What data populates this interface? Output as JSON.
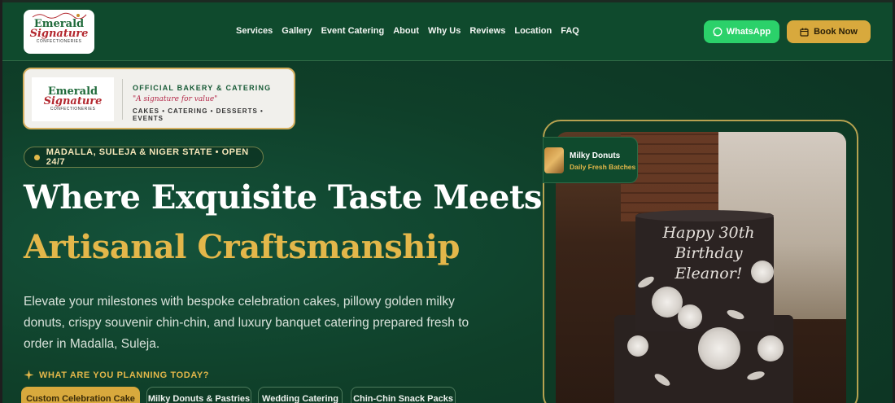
{
  "header": {
    "logo": {
      "line1": "Emerald",
      "line2": "Signature",
      "line3": "CONFECTIONERIES"
    },
    "nav": [
      "Services",
      "Gallery",
      "Event Catering",
      "About",
      "Why Us",
      "Reviews",
      "Location",
      "FAQ"
    ],
    "whatsapp_label": "WhatsApp",
    "book_label": "Book Now"
  },
  "badge": {
    "title": "OFFICIAL BAKERY & CATERING",
    "tagline": "\"A signature for value\"",
    "categories": "CAKES  •  CATERING  •  DESSERTS  •  EVENTS"
  },
  "hero": {
    "location": "MADALLA, SULEJA & NIGER STATE • OPEN 24/7",
    "headline_line1": "Where Exquisite Taste Meets",
    "headline_line2": "Artisanal Craftsmanship",
    "description": "Elevate your milestones with bespoke celebration cakes, pillowy golden milky donuts, crispy souvenir chin-chin, and luxury banquet catering prepared fresh to order in Madalla, Suleja.",
    "plan_label": "WHAT ARE YOU PLANNING TODAY?",
    "chips": [
      "Custom Celebration Cake",
      "Milky Donuts & Pastries",
      "Wedding Catering",
      "Chin-Chin Snack Packs"
    ],
    "active_chip_index": 0
  },
  "feature": {
    "tag_title": "Milky Donuts",
    "tag_sub": "Daily Fresh Batches",
    "cake_text": "Happy 30th Birthday Eleanor!"
  },
  "colors": {
    "accent_gold": "#d8a93d",
    "whatsapp_green": "#2bd16a",
    "header_green": "#0f4a2d"
  }
}
